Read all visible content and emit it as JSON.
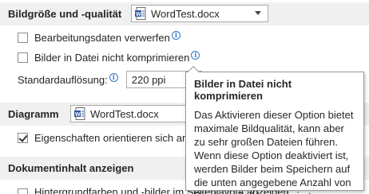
{
  "image_section": {
    "title": "Bildgröße und -qualität",
    "document": "WordTest.docx",
    "options": [
      {
        "label": "Bearbeitungsdaten verwerfen",
        "checked": false
      },
      {
        "label": "Bilder in Datei nicht komprimieren",
        "checked": false
      }
    ],
    "resolution_label": "Standardauflösung:",
    "resolution_value": "220 ppi"
  },
  "chart_section": {
    "title": "Diagramm",
    "document": "WordTest.docx",
    "option_label": "Eigenschaften orientieren sich am D",
    "option_checked": true
  },
  "content_section": {
    "title": "Dokumentinhalt anzeigen",
    "partial_option_label": "Hintergrundfarben und -bilder im Seitenlayout anzeigen"
  },
  "tooltip": {
    "title": "Bilder in Datei nicht komprimieren",
    "body": "Das Aktivieren dieser Option bietet maximale Bildqualität, kann aber zu sehr großen Dateien führen. Wenn diese Option deaktiviert ist, werden Bilder beim Speichern auf die unten angegebene Anzahl von Pixel pro Zoll komprimiert."
  },
  "icons": {
    "info": "info-icon",
    "document": "word-document-icon",
    "dropdown": "chevron-down-icon"
  },
  "colors": {
    "section_bg": "#f0f0f0",
    "info_blue": "#2b78c9",
    "word_blue": "#2b579a"
  }
}
